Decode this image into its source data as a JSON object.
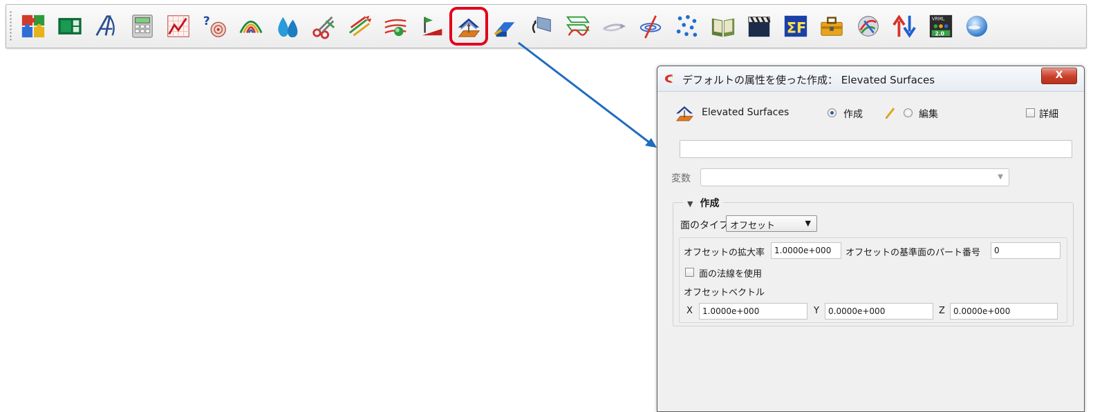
{
  "toolbar": {
    "icons": [
      {
        "name": "puzzle-icon"
      },
      {
        "name": "layout-panel-icon"
      },
      {
        "name": "annotation-text-icon"
      },
      {
        "name": "calculator-icon"
      },
      {
        "name": "xy-plot-icon"
      },
      {
        "name": "query-probe-icon"
      },
      {
        "name": "contour-icon"
      },
      {
        "name": "isosurface-drops-icon"
      },
      {
        "name": "cut-plane-icon"
      },
      {
        "name": "vector-arrows-icon"
      },
      {
        "name": "streamline-icon"
      },
      {
        "name": "particle-trace-icon"
      },
      {
        "name": "elevated-surfaces-icon"
      },
      {
        "name": "extrude-icon"
      },
      {
        "name": "revolve-icon"
      },
      {
        "name": "profile-curves-icon"
      },
      {
        "name": "pathline-icon"
      },
      {
        "name": "vortex-core-icon"
      },
      {
        "name": "point-cloud-icon"
      },
      {
        "name": "book-icon"
      },
      {
        "name": "animation-clapper-icon"
      },
      {
        "name": "sigma-f-icon"
      },
      {
        "name": "toolbox-icon"
      },
      {
        "name": "shader-icon"
      },
      {
        "name": "up-down-arrows-icon"
      },
      {
        "name": "vrml-export-icon",
        "text": "VRML 2.0"
      },
      {
        "name": "sky-globe-icon"
      }
    ],
    "selected_index": 12
  },
  "dialog": {
    "title": "デフォルトの属性を使った作成： Elevated Surfaces",
    "close_symbol": "X",
    "tool_name": "Elevated Surfaces",
    "mode_create_label": "作成",
    "mode_edit_label": "編集",
    "mode_selected": "create",
    "detail_label": "詳細",
    "detail_checked": false,
    "name_value": "",
    "variable_label": "変数",
    "variable_value": "",
    "section_title": "作成",
    "face_type_label": "面のタイプ",
    "face_type_value": "オフセット",
    "offset_scale_label": "オフセットの拡大率",
    "offset_scale_value": "1.0000e+000",
    "offset_part_label": "オフセットの基準面のパート番号",
    "offset_part_value": "0",
    "use_normal_label": "面の法線を使用",
    "use_normal_checked": false,
    "offset_vector_label": "オフセットベクトル",
    "vector": {
      "x_label": "X",
      "x_value": "1.0000e+000",
      "y_label": "Y",
      "y_value": "0.0000e+000",
      "z_label": "Z",
      "z_value": "0.0000e+000"
    }
  },
  "colors": {
    "highlight": "#e3001b",
    "arrow": "#1f6cc0",
    "dialog_bg": "#f0f0f0"
  }
}
